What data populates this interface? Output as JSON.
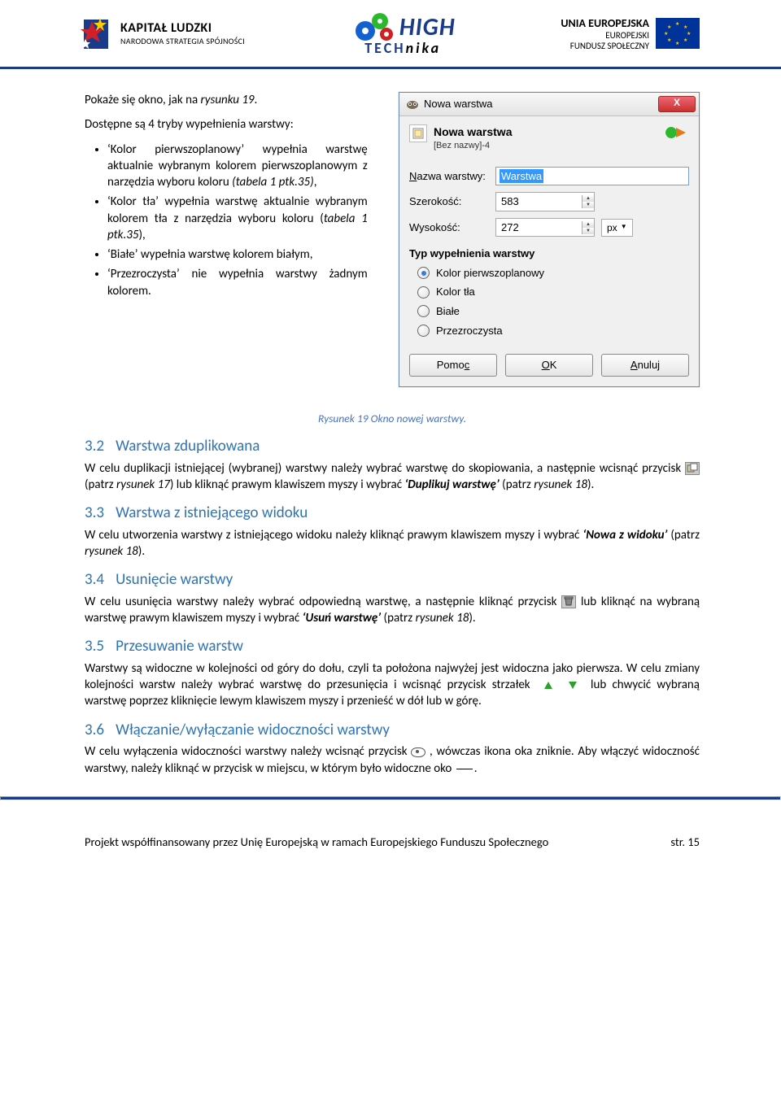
{
  "header": {
    "left_logo_title": "KAPITAŁ LUDZKI",
    "left_logo_sub": "NARODOWA STRATEGIA SPÓJNOŚCI",
    "center_logo_top": "HIGH",
    "center_logo_bottom": "TECHnika",
    "right_line1": "UNIA EUROPEJSKA",
    "right_line2": "EUROPEJSKI",
    "right_line3": "FUNDUSZ SPOŁECZNY"
  },
  "intro": {
    "p1_a": "Pokaże się okno, jak na ",
    "p1_em": "rysunku 19",
    "p1_b": ".",
    "p2": "Dostępne są 4 tryby wypełnienia warstwy:",
    "bullets": [
      {
        "a": "‘Kolor pierwszoplanowy’ wypełnia warstwę aktualnie wybranym kolorem pierwszoplanowym z narzędzia wyboru koloru ",
        "em": "(tabela 1 ptk.35)",
        "b": ","
      },
      {
        "a": "‘Kolor tła’ wypełnia warstwę aktualnie wybranym kolorem tła z narzędzia wyboru koloru (",
        "em": "tabela 1 ptk.35",
        "b": "),"
      },
      {
        "a": "‘Białe’ wypełnia warstwę kolorem białym,",
        "em": "",
        "b": ""
      },
      {
        "a": "‘Przezroczysta’ nie wypełnia warstwy żadnym kolorem.",
        "em": "",
        "b": ""
      }
    ]
  },
  "dialog": {
    "title": "Nowa warstwa",
    "header_title": "Nowa warstwa",
    "header_sub": "[Bez nazwy]-4",
    "name_label_a": "N",
    "name_label_b": "azwa warstwy:",
    "name_value": "Warstwa",
    "width_label": "Szerokość:",
    "width_value": "583",
    "height_label": "Wysokość:",
    "height_value": "272",
    "unit": "px",
    "section": "Typ wypełnienia warstwy",
    "radios": [
      "Kolor pierwszoplanowy",
      "Kolor tła",
      "Białe",
      "Przezroczysta"
    ],
    "radio_selected": 0,
    "btn_help_a": "Pomo",
    "btn_help_u": "c",
    "btn_ok_u": "O",
    "btn_ok_a": "K",
    "btn_cancel_u": "A",
    "btn_cancel_a": "nuluj"
  },
  "caption": "Rysunek 19 Okno nowej warstwy.",
  "sections": {
    "s32": {
      "num": "3.2",
      "title": "Warstwa zduplikowana",
      "p_a": "W celu duplikacji istniejącej (wybranej) warstwy należy wybrać warstwę do skopiowania, a następnie wcisnąć przycisk ",
      "p_b": " (patrz ",
      "p_em1": "rysunek 17",
      "p_c": ") lub kliknąć prawym klawiszem myszy i wybrać ",
      "p_strong": "‘Duplikuj warstwę’",
      "p_d": " (patrz ",
      "p_em2": "rysunek 18",
      "p_e": ")."
    },
    "s33": {
      "num": "3.3",
      "title": "Warstwa z istniejącego widoku",
      "p_a": "W celu utworzenia warstwy z istniejącego widoku należy kliknąć prawym klawiszem myszy i wybrać ",
      "p_strong": "‘Nowa z widoku’",
      "p_b": " (patrz ",
      "p_em": "rysunek 18",
      "p_c": ")."
    },
    "s34": {
      "num": "3.4",
      "title": "Usunięcie warstwy",
      "p_a": "W celu usunięcia warstwy należy wybrać odpowiedną warstwę, a następnie kliknąć przycisk ",
      "p_b": " lub kliknąć na wybraną warstwę prawym klawiszem myszy i wybrać ",
      "p_strong": "‘Usuń warstwę’",
      "p_c": " (patrz ",
      "p_em": "rysunek 18",
      "p_d": ")."
    },
    "s35": {
      "num": "3.5",
      "title": "Przesuwanie warstw",
      "p_a": "Warstwy są widoczne w kolejności od góry do dołu, czyli ta położona najwyżej jest widoczna jako pierwsza. W celu zmiany kolejności warstw należy wybrać warstwę do przesunięcia i wcisnąć przycisk strzałek ",
      "p_b": " lub chwycić wybraną warstwę poprzez kliknięcie lewym klawiszem myszy i przenieść w dół lub w górę."
    },
    "s36": {
      "num": "3.6",
      "title": "Włączanie/wyłączanie widoczności warstwy",
      "p_a": "W celu wyłączenia widoczności warstwy należy wcisnąć przycisk  ",
      "p_b": " , wówczas ikona oka zniknie. Aby włączyć widoczność warstwy, należy kliknąć w przycisk w miejscu, w którym było widoczne oko ",
      "p_c": "."
    }
  },
  "footer": {
    "text": "Projekt współfinansowany przez Unię Europejską w ramach Europejskiego Funduszu Społecznego",
    "page": "str. 15"
  }
}
